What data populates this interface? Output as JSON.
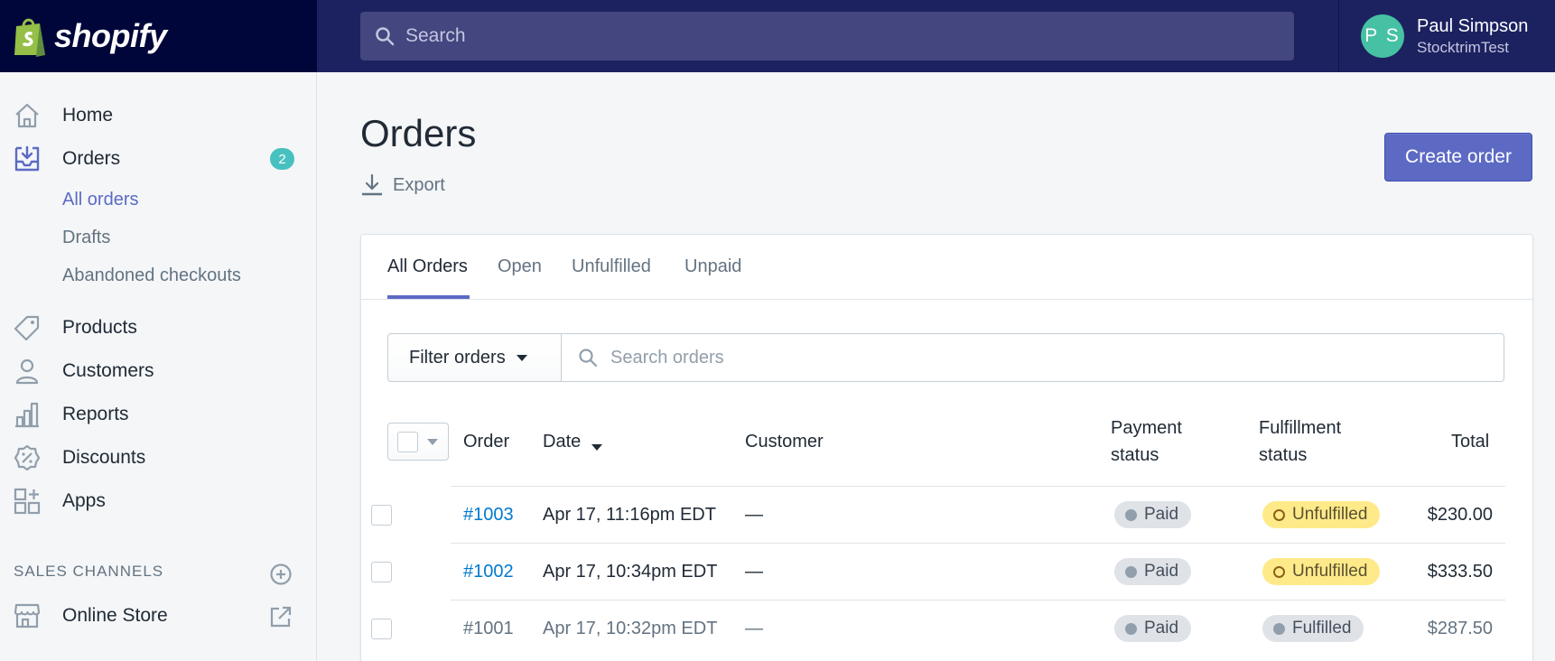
{
  "topbar": {
    "logo_text": "shopify",
    "search_placeholder": "Search",
    "user": {
      "initials": "P S",
      "name": "Paul Simpson",
      "store": "StocktrimTest"
    }
  },
  "sidebar": {
    "items": [
      {
        "label": "Home",
        "icon": "home-icon"
      },
      {
        "label": "Orders",
        "icon": "orders-icon",
        "badge": "2"
      },
      {
        "label": "Products",
        "icon": "tag-icon"
      },
      {
        "label": "Customers",
        "icon": "person-icon"
      },
      {
        "label": "Reports",
        "icon": "bar-chart-icon"
      },
      {
        "label": "Discounts",
        "icon": "discount-icon"
      },
      {
        "label": "Apps",
        "icon": "apps-icon"
      }
    ],
    "orders_sub": [
      "All orders",
      "Drafts",
      "Abandoned checkouts"
    ],
    "sales_channels_title": "SALES CHANNELS",
    "online_store": "Online Store"
  },
  "page": {
    "title": "Orders",
    "export_label": "Export",
    "create_label": "Create order"
  },
  "tabs": [
    "All Orders",
    "Open",
    "Unfulfilled",
    "Unpaid"
  ],
  "filter": {
    "button_label": "Filter orders",
    "search_placeholder": "Search orders"
  },
  "table": {
    "headers": {
      "order": "Order",
      "date": "Date",
      "customer": "Customer",
      "payment_1": "Payment",
      "payment_2": "status",
      "fulfillment_1": "Fulfillment",
      "fulfillment_2": "status",
      "total": "Total"
    },
    "rows": [
      {
        "order": "#1003",
        "date": "Apr 17, 11:16pm EDT",
        "customer": "—",
        "payment": "Paid",
        "fulfillment": "Unfulfilled",
        "total": "$230.00"
      },
      {
        "order": "#1002",
        "date": "Apr 17, 10:34pm EDT",
        "customer": "—",
        "payment": "Paid",
        "fulfillment": "Unfulfilled",
        "total": "$333.50"
      },
      {
        "order": "#1001",
        "date": "Apr 17, 10:32pm EDT",
        "customer": "—",
        "payment": "Paid",
        "fulfillment": "Fulfilled",
        "total": "$287.50"
      }
    ]
  },
  "colors": {
    "brand": "#5c6ac4",
    "topbar": "#1c2260",
    "logo_bg": "#000639",
    "avatar": "#47c1a3",
    "badge": "#47c1bf",
    "link": "#007ace",
    "unfulfilled": "#ffea8a"
  }
}
